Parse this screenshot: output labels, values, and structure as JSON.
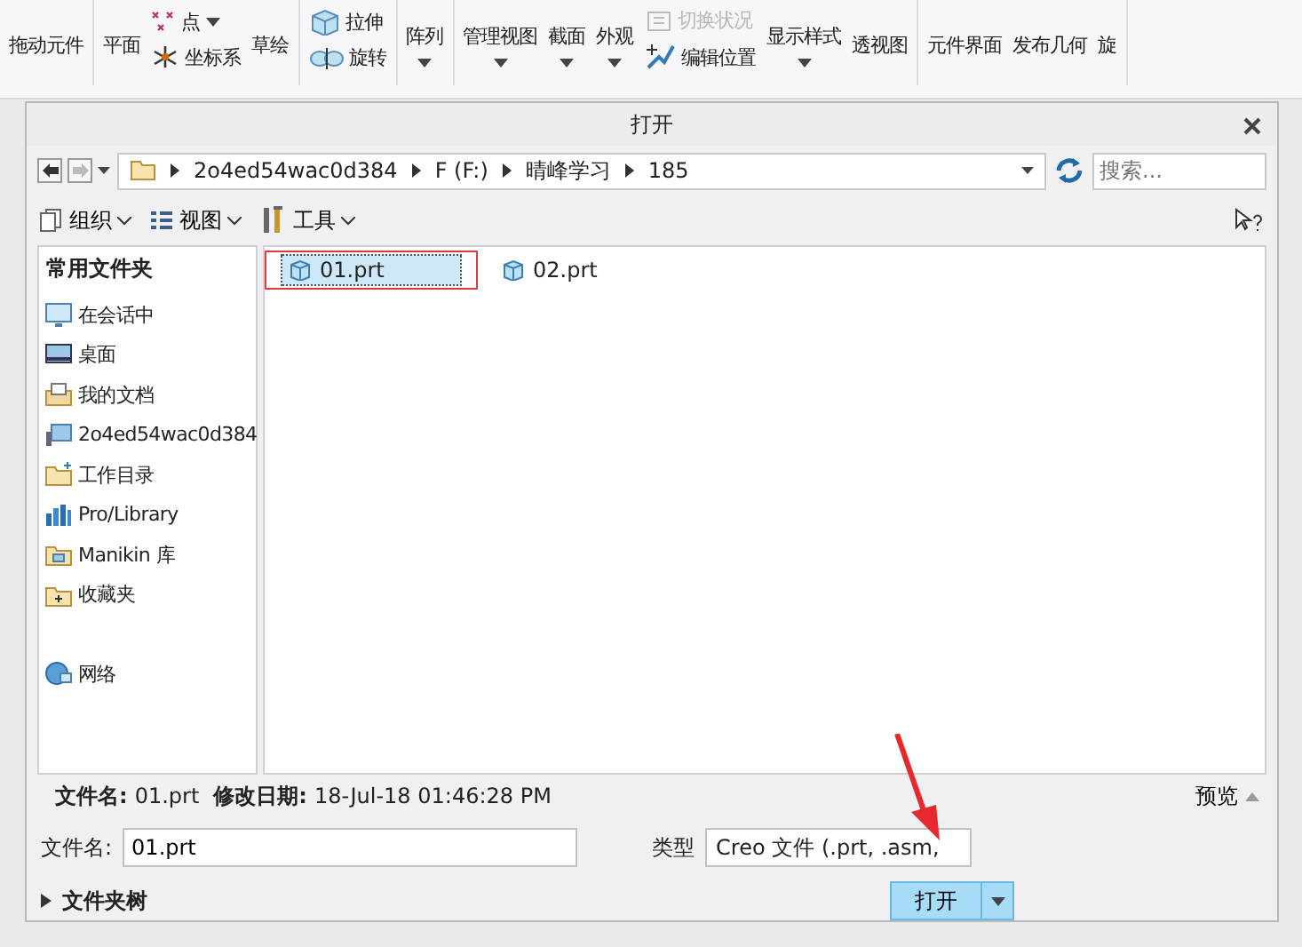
{
  "ribbon": {
    "groups": [
      {
        "columns": [
          [
            {
              "label": "拖动元件",
              "kind": "text",
              "dropdown": false,
              "disabled": false
            }
          ]
        ]
      },
      {
        "columns": [
          [
            {
              "label": "平面",
              "kind": "text",
              "dropdown": false,
              "disabled": false
            }
          ],
          [
            {
              "label": "点",
              "kind": "points",
              "dropdown": true,
              "disabled": false
            },
            {
              "label": "坐标系",
              "kind": "axes",
              "dropdown": false,
              "disabled": false
            }
          ],
          [
            {
              "label": "草绘",
              "kind": "text",
              "dropdown": false,
              "disabled": false
            }
          ]
        ]
      },
      {
        "columns": [
          [
            {
              "label": "拉伸",
              "kind": "cube",
              "dropdown": false,
              "disabled": false
            },
            {
              "label": "旋转",
              "kind": "revolve",
              "dropdown": false,
              "disabled": false
            }
          ]
        ]
      },
      {
        "columns": [
          [
            {
              "label": "阵列",
              "kind": "text",
              "dropdown": true,
              "disabled": false
            }
          ]
        ]
      },
      {
        "columns": [
          [
            {
              "label": "管理视图",
              "kind": "text",
              "dropdown": true,
              "disabled": false
            }
          ],
          [
            {
              "label": "截面",
              "kind": "text",
              "dropdown": true,
              "disabled": false
            }
          ],
          [
            {
              "label": "外观",
              "kind": "text",
              "dropdown": true,
              "disabled": false
            }
          ],
          [
            {
              "label": "切换状况",
              "kind": "toggle",
              "dropdown": false,
              "disabled": true
            },
            {
              "label": "编辑位置",
              "kind": "move",
              "dropdown": false,
              "disabled": false
            }
          ],
          [
            {
              "label": "显示样式",
              "kind": "text",
              "dropdown": true,
              "disabled": false
            }
          ],
          [
            {
              "label": "透视图",
              "kind": "text",
              "dropdown": false,
              "disabled": false
            }
          ]
        ]
      },
      {
        "columns": [
          [
            {
              "label": "元件界面",
              "kind": "text",
              "dropdown": false,
              "disabled": false
            }
          ],
          [
            {
              "label": "发布几何",
              "kind": "text",
              "dropdown": false,
              "disabled": false
            }
          ],
          [
            {
              "label": "旋",
              "kind": "text",
              "dropdown": false,
              "disabled": false
            }
          ]
        ]
      }
    ]
  },
  "dialog": {
    "title": "打开",
    "path": [
      "2o4ed54wac0d384",
      "F (F:)",
      "晴峰学习",
      "185"
    ],
    "search": {
      "placeholder": "搜索..."
    },
    "toolbar": [
      {
        "label": "组织",
        "kind": "organize"
      },
      {
        "label": "视图",
        "kind": "view"
      },
      {
        "label": "工具",
        "kind": "tools"
      }
    ],
    "sidebar": {
      "heading": "常用文件夹",
      "items": [
        {
          "label": "在会话中",
          "kind": "session"
        },
        {
          "label": "桌面",
          "kind": "desktop"
        },
        {
          "label": "我的文档",
          "kind": "documents"
        },
        {
          "label": "2o4ed54wac0d384",
          "kind": "computer"
        },
        {
          "label": "工作目录",
          "kind": "workdir"
        },
        {
          "label": "Pro/Library",
          "kind": "library"
        },
        {
          "label": "Manikin 库",
          "kind": "folder"
        },
        {
          "label": "收藏夹",
          "kind": "favorites"
        },
        {
          "label": "网络",
          "kind": "network"
        }
      ]
    },
    "files": [
      {
        "name": "01.prt",
        "selected": true,
        "highlighted": true
      },
      {
        "name": "02.prt",
        "selected": false,
        "highlighted": false
      }
    ],
    "details": [
      {
        "label": "文件名:",
        "value": "01.prt"
      },
      {
        "label": "修改日期:",
        "value": "18-Jul-18 01:46:28 PM"
      }
    ],
    "preview": "预览",
    "filename": {
      "label": "文件名:",
      "value": "01.prt"
    },
    "type": {
      "label": "类型",
      "value": "Creo 文件 (.prt, .asm,"
    },
    "open_button": "打开",
    "folder_tree": "文件夹树"
  }
}
